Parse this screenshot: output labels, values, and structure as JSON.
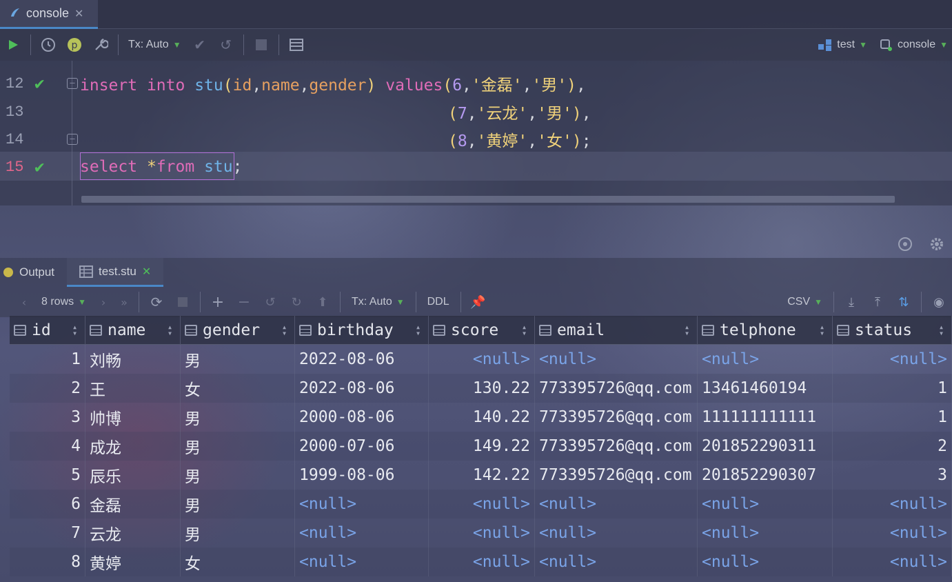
{
  "window": {
    "tab_label": "console"
  },
  "toolbar": {
    "tx_mode": "Tx: Auto",
    "datasource": "test",
    "session": "console"
  },
  "editor": {
    "line_numbers": [
      "12",
      "13",
      "14",
      "15"
    ]
  },
  "results": {
    "tabs": [
      {
        "label": "Output"
      },
      {
        "label": "test.stu"
      }
    ],
    "row_count": "8 rows",
    "tx_mode": "Tx: Auto",
    "ddl_label": "DDL",
    "export_format": "CSV",
    "columns": [
      "id",
      "name",
      "gender",
      "birthday",
      "score",
      "email",
      "telphone",
      "status"
    ],
    "rows": [
      [
        "1",
        "刘畅",
        "男",
        "2022-08-06",
        "<null>",
        "<null>",
        "<null>",
        "<null>"
      ],
      [
        "2",
        "王",
        "女",
        "2022-08-06",
        "130.22",
        "773395726@qq.com",
        "13461460194",
        "1"
      ],
      [
        "3",
        "帅博",
        "男",
        "2000-08-06",
        "140.22",
        "773395726@qq.com",
        "111111111111",
        "1"
      ],
      [
        "4",
        "成龙",
        "男",
        "2000-07-06",
        "149.22",
        "773395726@qq.com",
        "201852290311",
        "2"
      ],
      [
        "5",
        "辰乐",
        "男",
        "1999-08-06",
        "142.22",
        "773395726@qq.com",
        "201852290307",
        "3"
      ],
      [
        "6",
        "金磊",
        "男",
        "<null>",
        "<null>",
        "<null>",
        "<null>",
        "<null>"
      ],
      [
        "7",
        "云龙",
        "男",
        "<null>",
        "<null>",
        "<null>",
        "<null>",
        "<null>"
      ],
      [
        "8",
        "黄婷",
        "女",
        "<null>",
        "<null>",
        "<null>",
        "<null>",
        "<null>"
      ]
    ]
  },
  "colors": {
    "accent": "#4a88c7",
    "keyword": "#e06cb8",
    "identifier": "#6fb3e8",
    "string": "#f0d27a",
    "number": "#b59af0",
    "null": "#7aa4e8",
    "success": "#4fbf5a"
  }
}
